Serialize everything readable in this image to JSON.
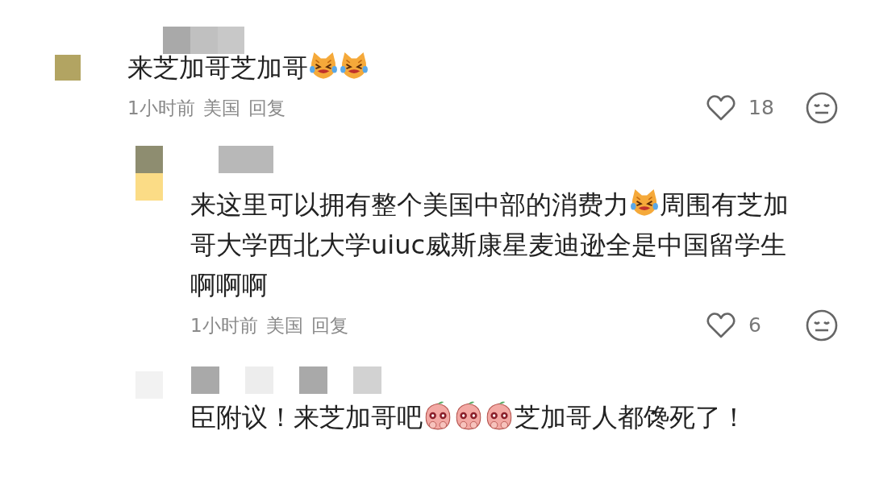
{
  "comments": [
    {
      "kind": "comment",
      "lines": [
        [
          {
            "kind": "text",
            "text": "来芝加哥芝加哥"
          },
          {
            "kind": "cat"
          },
          {
            "kind": "cat"
          }
        ]
      ],
      "time": "1小时前",
      "location": "美国",
      "reply_label": "回复",
      "likes": "18",
      "liked": false
    },
    {
      "kind": "reply",
      "lines": [
        [
          {
            "kind": "text",
            "text": "来这里可以拥有整个美国中部的消费力"
          },
          {
            "kind": "cat"
          },
          {
            "kind": "text",
            "text": "周围有芝加"
          }
        ],
        [
          {
            "kind": "text",
            "text": "哥大学西北大学uiuc威斯康星麦迪逊全是中国留学生"
          }
        ],
        [
          {
            "kind": "text",
            "text": "啊啊啊"
          }
        ]
      ],
      "time": "1小时前",
      "location": "美国",
      "reply_label": "回复",
      "likes": "6",
      "liked": false
    },
    {
      "kind": "reply",
      "lines": [
        [
          {
            "kind": "text",
            "text": "臣附议！来芝加哥吧"
          },
          {
            "kind": "peach"
          },
          {
            "kind": "peach"
          },
          {
            "kind": "peach"
          },
          {
            "kind": "text",
            "text": "芝加哥人都馋死了！"
          }
        ]
      ]
    }
  ]
}
